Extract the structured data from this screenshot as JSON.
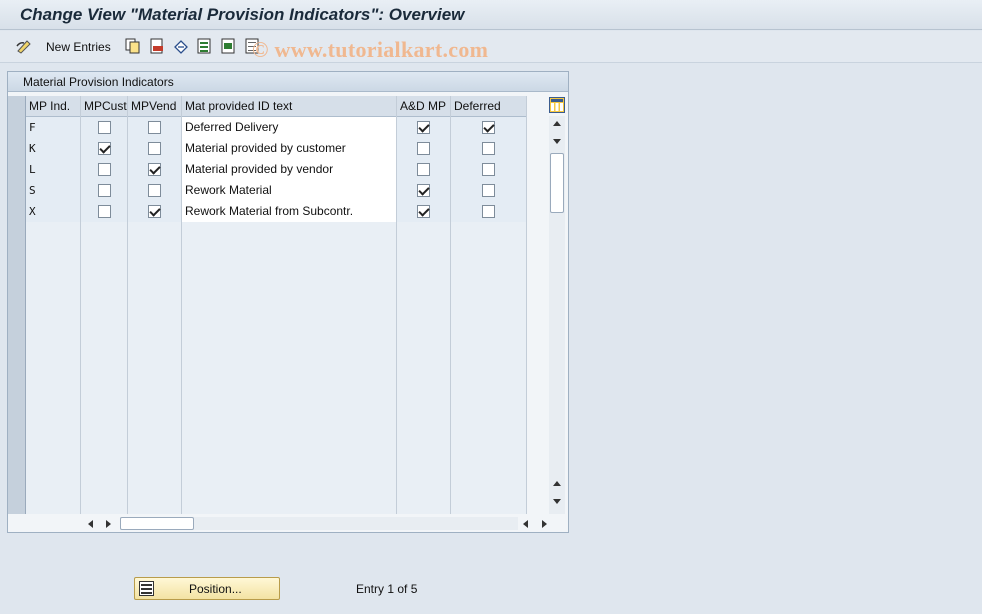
{
  "window": {
    "title": "Change View \"Material Provision Indicators\": Overview"
  },
  "toolbar": {
    "new_entries_label": "New Entries",
    "icons": [
      "edit-glasses-icon",
      "copy-icon",
      "delete-icon",
      "undo-icon",
      "select-all-icon",
      "select-block-icon",
      "deselect-all-icon"
    ]
  },
  "watermark": "© www.tutorialkart.com",
  "table": {
    "title": "Material Provision Indicators",
    "columns": [
      "MP Ind.",
      "MPCust",
      "MPVend",
      "Mat provided ID text",
      "A&D MP",
      "Deferred"
    ],
    "rows": [
      {
        "ind": "F",
        "mpcust": false,
        "mpvend": false,
        "text": "Deferred Delivery",
        "admp": true,
        "deferred": true
      },
      {
        "ind": "K",
        "mpcust": true,
        "mpvend": false,
        "text": "Material provided by customer",
        "admp": false,
        "deferred": false
      },
      {
        "ind": "L",
        "mpcust": false,
        "mpvend": true,
        "text": "Material provided by vendor",
        "admp": false,
        "deferred": false
      },
      {
        "ind": "S",
        "mpcust": false,
        "mpvend": false,
        "text": "Rework Material",
        "admp": true,
        "deferred": false
      },
      {
        "ind": "X",
        "mpcust": false,
        "mpvend": true,
        "text": "Rework Material from Subcontr.",
        "admp": true,
        "deferred": false
      }
    ],
    "empty_rows": 14
  },
  "footer": {
    "position_label": "Position...",
    "entry_text": "Entry 1 of 5"
  },
  "colors": {
    "accent_button": "#f3e3a3",
    "background": "#dfe6ee"
  }
}
